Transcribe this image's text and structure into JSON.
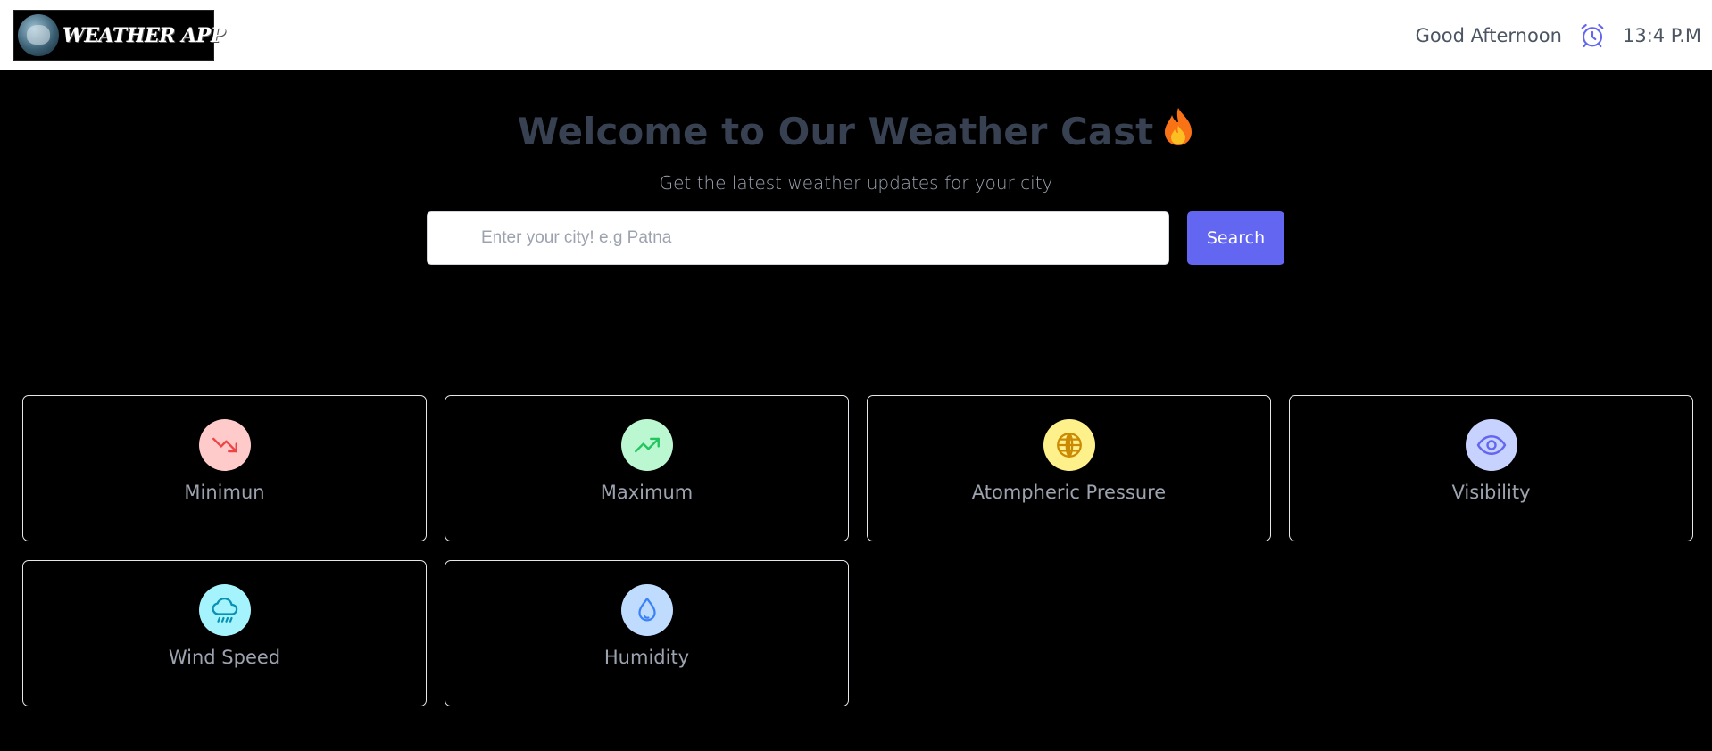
{
  "header": {
    "logo_text": "WEATHER APP",
    "greeting": "Good Afternoon",
    "time": "13:4 P.M",
    "icons": [
      "alarm-clock-icon"
    ]
  },
  "hero": {
    "title": "Welcome to Our Weather Cast",
    "title_icon": "fire-icon",
    "subtitle": "Get the latest weather updates for your city"
  },
  "search": {
    "placeholder": "Enter your city! e.g Patna",
    "value": "",
    "button_label": "Search"
  },
  "cards": [
    {
      "label": "Minimun",
      "icon": "trending-down-icon",
      "icon_bg": "#fecaca",
      "icon_color": "#ef4444"
    },
    {
      "label": "Maximum",
      "icon": "trending-up-icon",
      "icon_bg": "#bbf7d0",
      "icon_color": "#22c55e"
    },
    {
      "label": "Atompheric Pressure",
      "icon": "globe-icon",
      "icon_bg": "#fef08a",
      "icon_color": "#ca8a04"
    },
    {
      "label": "Visibility",
      "icon": "eye-icon",
      "icon_bg": "#c7d2fe",
      "icon_color": "#6366f1"
    },
    {
      "label": "Wind Speed",
      "icon": "cloud-rain-icon",
      "icon_bg": "#a5f3fc",
      "icon_color": "#06b6d4"
    },
    {
      "label": "Humidity",
      "icon": "droplet-icon",
      "icon_bg": "#bfdbfe",
      "icon_color": "#3b82f6"
    }
  ],
  "colors": {
    "accent": "#6366f1",
    "background": "#000000",
    "topbar": "#ffffff"
  }
}
